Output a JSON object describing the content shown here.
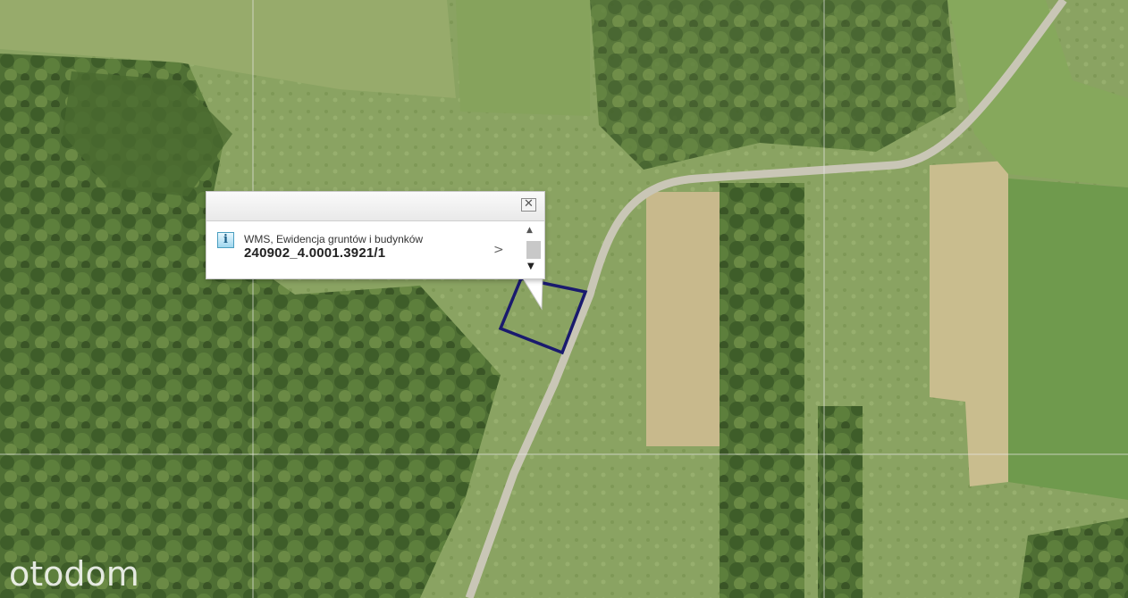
{
  "popup": {
    "layer_name": "WMS, Ewidencja gruntów i budynków",
    "feature_id": "240902_4.0001.3921/1",
    "close_icon": "close-icon",
    "info_icon_glyph": "i",
    "next_glyph": ">",
    "scroll_up_glyph": "▲",
    "scroll_down_glyph": "▼"
  },
  "watermark": {
    "text": "otodom"
  },
  "colors": {
    "parcel_outline": "#1a1a6e",
    "road": "#c9c6b6",
    "grid_line": "#e8e8e8"
  }
}
